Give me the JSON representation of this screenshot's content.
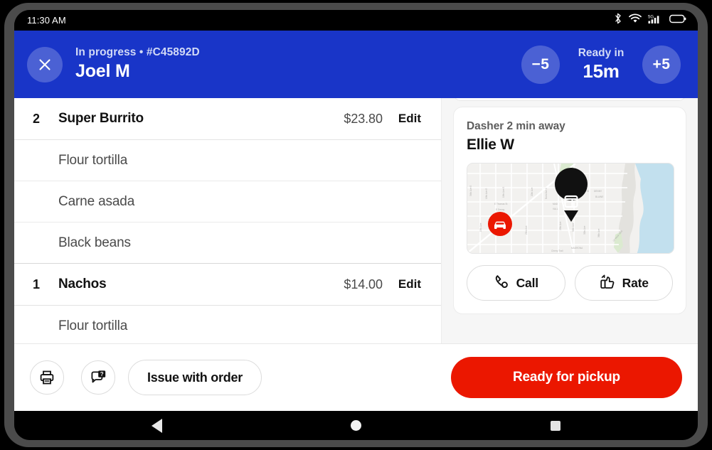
{
  "status_bar": {
    "time": "11:30 AM",
    "icons": [
      "bluetooth-icon",
      "wifi-icon",
      "cellular-5g-icon",
      "battery-icon"
    ],
    "cellular_label": "5G"
  },
  "header": {
    "close_icon": "close-icon",
    "status_line": "In progress • #C45892D",
    "customer_name": "Joel M",
    "decrease_label": "−5",
    "increase_label": "+5",
    "ready_label": "Ready in",
    "ready_value": "15m",
    "background_color": "#1935c8"
  },
  "order_items": [
    {
      "qty": "2",
      "name": "Super Burrito",
      "price": "$23.80",
      "edit_label": "Edit",
      "options": [
        "Flour tortilla",
        "Carne asada",
        "Black beans"
      ]
    },
    {
      "qty": "1",
      "name": "Nachos",
      "price": "$14.00",
      "edit_label": "Edit",
      "options": [
        "Flour tortilla"
      ]
    }
  ],
  "dasher": {
    "eta_text": "Dasher 2 min away",
    "name": "Ellie W",
    "map": {
      "store_marker": "store-pin-icon",
      "dasher_marker": "car-marker-icon",
      "street_labels": [
        "E Thomas St",
        "E Denny Way",
        "E Harrison St",
        "DENNY BLAINE",
        "MADRONA",
        "23rd Ave",
        "Lake Washington Blvd"
      ]
    },
    "actions": [
      {
        "label": "Call",
        "icon": "phone-icon"
      },
      {
        "label": "Rate",
        "icon": "thumbs-up-icon"
      }
    ]
  },
  "bottom_bar": {
    "print_icon": "printer-icon",
    "support_icon": "chat-help-icon",
    "issue_label": "Issue with order",
    "primary_label": "Ready for pickup",
    "primary_color": "#eb1700"
  },
  "nav_bar": {
    "back": "back-triangle-icon",
    "home": "home-circle-icon",
    "recents": "recents-square-icon"
  }
}
